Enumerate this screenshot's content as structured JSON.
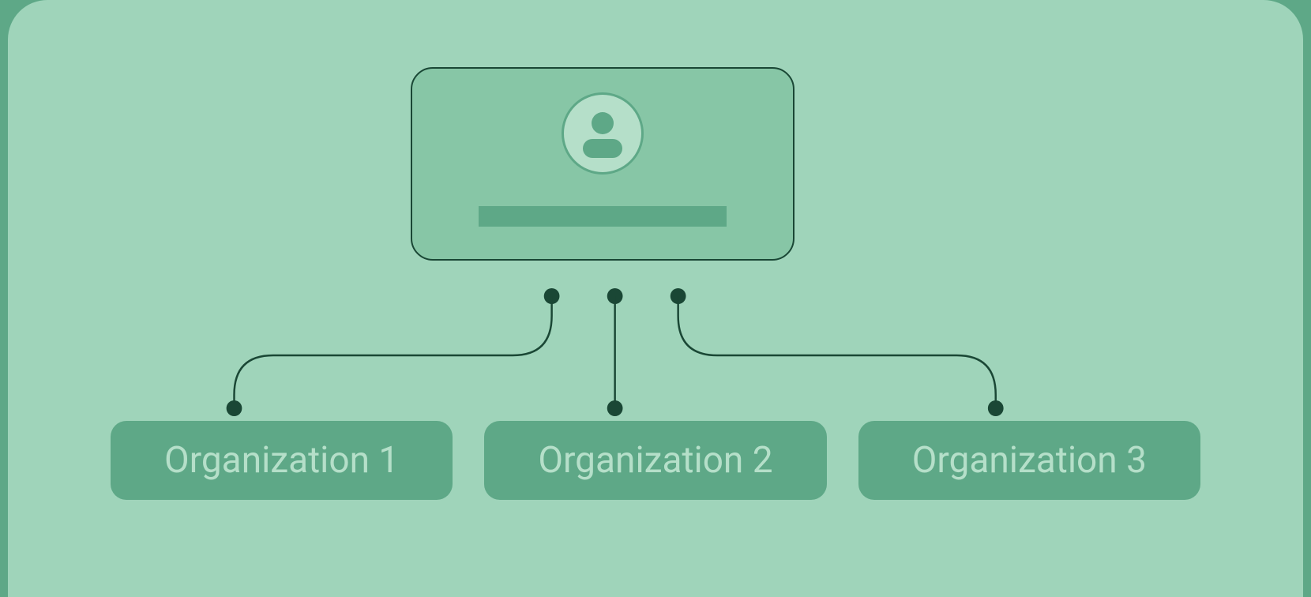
{
  "diagram": {
    "user_icon": "person-icon",
    "organizations": [
      {
        "label": "Organization 1"
      },
      {
        "label": "Organization 2"
      },
      {
        "label": "Organization 3"
      }
    ]
  },
  "colors": {
    "outer_bg": "#5ea887",
    "panel_bg": "#9fd4ba",
    "card_bg": "#87c6a6",
    "card_border": "#1a4735",
    "icon_circle": "#b5dfc9",
    "icon_fill": "#5ea887",
    "org_bg": "#5ea887",
    "org_text": "#b5dfc9",
    "connector": "#1a4735"
  }
}
